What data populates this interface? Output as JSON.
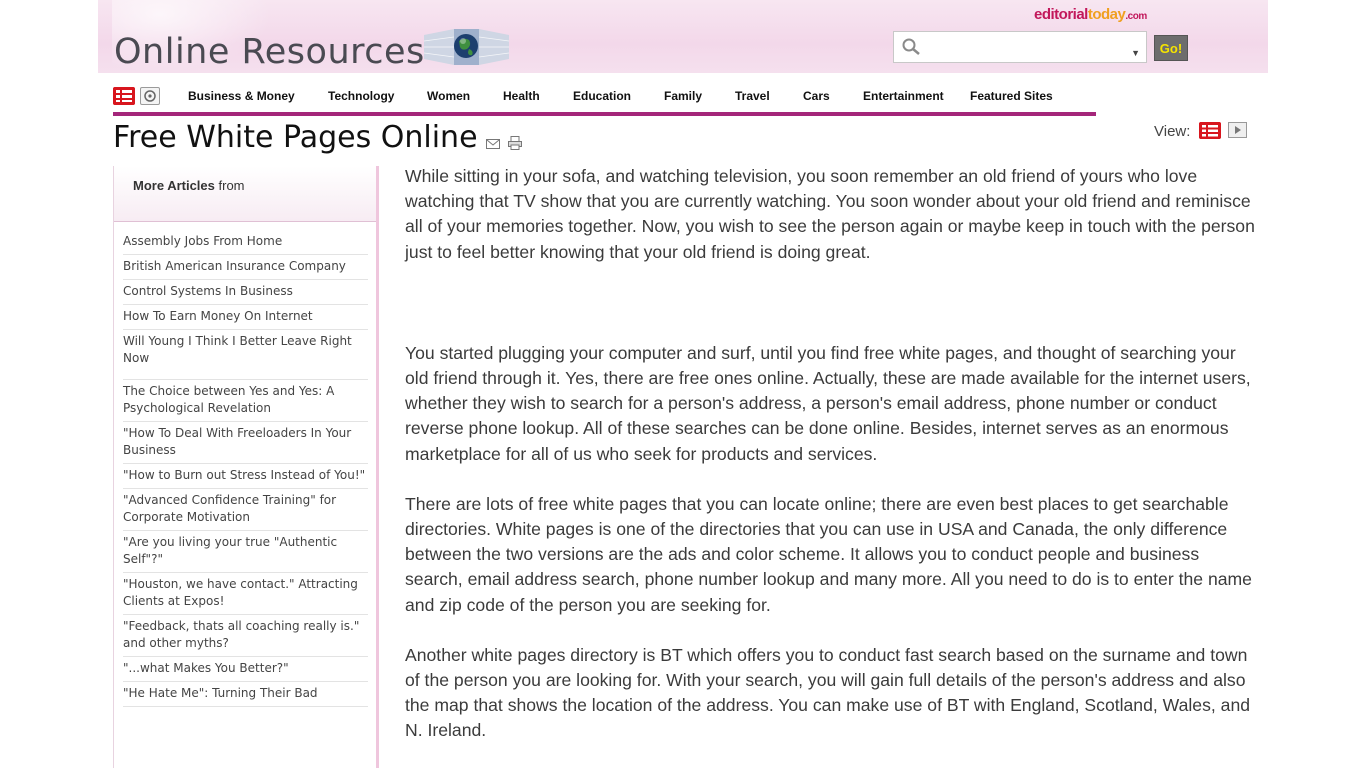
{
  "header": {
    "site_title": "Online Resources",
    "brand": {
      "part1": "editorial",
      "part2": "today",
      "part3": ".com"
    },
    "search": {
      "placeholder": "",
      "value": ""
    },
    "go_label": "Go!"
  },
  "nav": {
    "items": [
      "Business & Money",
      "Technology",
      "Women",
      "Health",
      "Education",
      "Family",
      "Travel",
      "Cars",
      "Entertainment",
      "Featured Sites"
    ]
  },
  "page": {
    "title": "Free White Pages Online",
    "view_label": "View:"
  },
  "sidebar": {
    "heading_bold": "More Articles",
    "heading_rest": " from",
    "items": [
      "Assembly Jobs From Home",
      "British American Insurance Company",
      "Control Systems In Business",
      "How To Earn Money On Internet",
      "Will Young I Think I Better Leave Right Now",
      "The Choice between Yes and Yes: A Psychological Revelation",
      "\"How To Deal With Freeloaders In Your Business",
      "\"How to Burn out Stress Instead of You!\"",
      "\"Advanced Confidence Training\" for Corporate Motivation",
      "\"Are you living your true \"Authentic Self\"?\"",
      "\"Houston, we have contact.\" Attracting Clients at Expos!",
      "\"Feedback, thats all coaching really is.\" and other myths?",
      "\"...what Makes You Better?\"",
      "\"He Hate Me\": Turning Their Bad"
    ]
  },
  "article": {
    "paragraphs": [
      "While sitting in your sofa, and watching television, you soon remember an old friend of yours who love watching that TV show that you are currently watching. You soon wonder about your old friend and reminisce all of your memories together. Now, you wish to see the person again or maybe keep in touch with the person just to feel better knowing that your old friend is doing great.",
      "You started plugging your computer and surf, until you find free white pages, and thought of searching your old friend through it. Yes, there are free ones online. Actually, these are made available for the internet users, whether they wish to search for a person's address, a person's email address, phone number or conduct reverse phone lookup. All of these searches can be done online. Besides, internet serves as an enormous marketplace for all of us who seek for products and services.",
      "There are lots of free white pages that you can locate online; there are even best places to get searchable directories. White pages is one of the directories that you can use in USA and Canada, the only difference between the two versions are the ads and color scheme. It allows you to conduct people and business search, email address search, phone number lookup and many more. All you need to do is to enter the name and zip code of the person you are seeking for.",
      "Another white pages directory is BT which offers you to conduct fast search based on the surname and town of the person you are looking for. With your search, you will gain full details of the person's address and also the map that shows the location of the address. You can make use of BT with England, Scotland, Wales, and N. Ireland."
    ]
  },
  "colors": {
    "accent": "#a4267a",
    "red_icon": "#d8161e",
    "go_text": "#f5e400"
  }
}
